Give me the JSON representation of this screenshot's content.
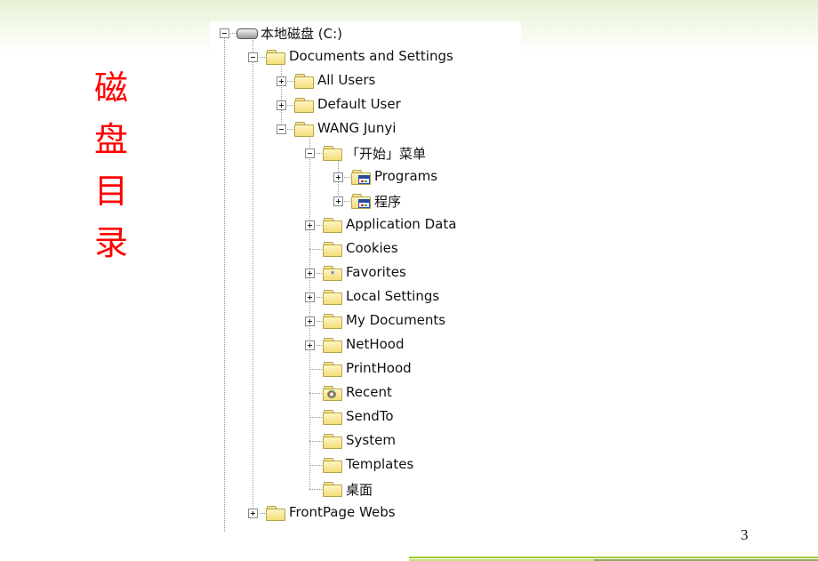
{
  "slide": {
    "side_title_chars": [
      "磁",
      "盘",
      "目",
      "录"
    ],
    "page_number": "3",
    "accent_color": "#ff0000",
    "header_gradient_color": "#e6f2d4",
    "footer_line_color": "#9acd32"
  },
  "tree": {
    "nodes": [
      {
        "label": "本地磁盘 (C:)",
        "level": 0,
        "icon": "drive-icon",
        "toggle": "minus"
      },
      {
        "label": "Documents and Settings",
        "level": 1,
        "icon": "folder-icon",
        "toggle": "minus"
      },
      {
        "label": "All Users",
        "level": 2,
        "icon": "folder-icon",
        "toggle": "plus"
      },
      {
        "label": "Default User",
        "level": 2,
        "icon": "folder-icon",
        "toggle": "plus"
      },
      {
        "label": "WANG Junyi",
        "level": 2,
        "icon": "folder-icon",
        "toggle": "minus"
      },
      {
        "label": "「开始」菜单",
        "level": 3,
        "icon": "folder-icon",
        "toggle": "minus"
      },
      {
        "label": "Programs",
        "level": 4,
        "icon": "program-folder-icon",
        "toggle": "plus"
      },
      {
        "label": "程序",
        "level": 4,
        "icon": "program-folder-icon",
        "toggle": "plus"
      },
      {
        "label": "Application Data",
        "level": 3,
        "icon": "folder-icon",
        "toggle": "plus"
      },
      {
        "label": "Cookies",
        "level": 3,
        "icon": "folder-icon",
        "toggle": "none"
      },
      {
        "label": "Favorites",
        "level": 3,
        "icon": "favorites-folder-icon",
        "toggle": "plus"
      },
      {
        "label": "Local Settings",
        "level": 3,
        "icon": "folder-icon",
        "toggle": "plus"
      },
      {
        "label": "My Documents",
        "level": 3,
        "icon": "folder-icon",
        "toggle": "plus"
      },
      {
        "label": "NetHood",
        "level": 3,
        "icon": "folder-icon",
        "toggle": "plus"
      },
      {
        "label": "PrintHood",
        "level": 3,
        "icon": "folder-icon",
        "toggle": "none"
      },
      {
        "label": "Recent",
        "level": 3,
        "icon": "recent-folder-icon",
        "toggle": "none"
      },
      {
        "label": "SendTo",
        "level": 3,
        "icon": "folder-icon",
        "toggle": "none"
      },
      {
        "label": "System",
        "level": 3,
        "icon": "folder-icon",
        "toggle": "none"
      },
      {
        "label": "Templates",
        "level": 3,
        "icon": "folder-icon",
        "toggle": "none"
      },
      {
        "label": "桌面",
        "level": 3,
        "icon": "folder-icon",
        "toggle": "none"
      },
      {
        "label": "FrontPage Webs",
        "level": 1,
        "icon": "folder-icon",
        "toggle": "plus"
      }
    ]
  }
}
